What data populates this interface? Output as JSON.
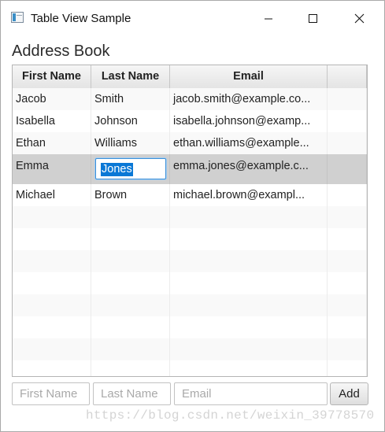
{
  "window": {
    "title": "Table View Sample",
    "icons": {
      "app": "table-app-icon",
      "minimize": "minimize-icon",
      "maximize": "maximize-icon",
      "close": "close-icon"
    }
  },
  "main": {
    "heading": "Address Book",
    "table": {
      "columns": [
        "First Name",
        "Last Name",
        "Email",
        ""
      ],
      "rows": [
        {
          "first": "Jacob",
          "last": "Smith",
          "email": "jacob.smith@example.co..."
        },
        {
          "first": "Isabella",
          "last": "Johnson",
          "email": "isabella.johnson@examp..."
        },
        {
          "first": "Ethan",
          "last": "Williams",
          "email": "ethan.williams@example..."
        },
        {
          "first": "Emma",
          "last": "Jones",
          "email": "emma.jones@example.c..."
        },
        {
          "first": "Michael",
          "last": "Brown",
          "email": "michael.brown@exampl..."
        }
      ],
      "selected_row": 3,
      "editing": {
        "column": "Last Name",
        "value": "Jones"
      }
    }
  },
  "form": {
    "first_name_placeholder": "First Name",
    "last_name_placeholder": "Last Name",
    "email_placeholder": "Email",
    "add_label": "Add"
  },
  "watermark": "https://blog.csdn.net/weixin_39778570",
  "colors": {
    "selection_row": "#d0d0d0",
    "edit_highlight": "#0a78d6",
    "edit_focus_border": "#3b8fd8"
  }
}
